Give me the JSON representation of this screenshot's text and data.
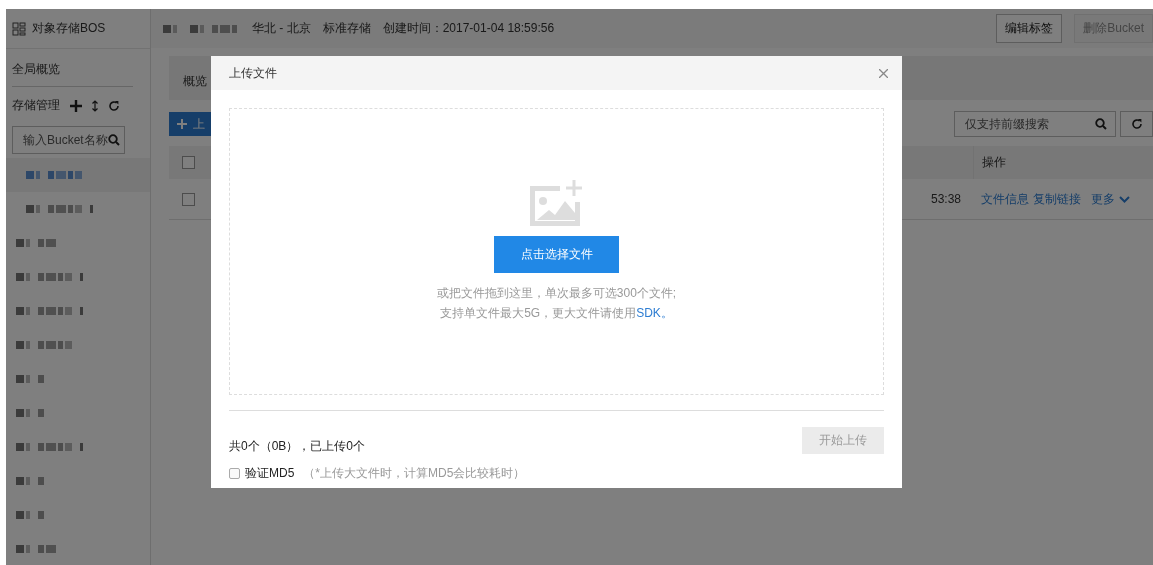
{
  "sidebar": {
    "title": "对象存储BOS",
    "overview": "全局概览",
    "storage_label": "存储管理",
    "search": {
      "placeholder": "输入Bucket名称"
    },
    "buckets": [
      {
        "selected": true
      },
      {
        "selected": false
      },
      {
        "selected": false
      },
      {
        "selected": false
      },
      {
        "selected": false
      },
      {
        "selected": false
      },
      {
        "selected": false
      },
      {
        "selected": false
      },
      {
        "selected": false
      },
      {
        "selected": false
      },
      {
        "selected": false
      },
      {
        "selected": false
      }
    ]
  },
  "header": {
    "region": "华北 - 北京",
    "storage_class": "标准存储",
    "created": "创建时间：2017-01-04 18:59:56",
    "buttons": [
      {
        "label": "编辑标签",
        "disabled": false
      },
      {
        "label": "删除Bucket",
        "disabled": true
      }
    ]
  },
  "tabs": [
    "概览"
  ],
  "toolbar": {
    "upload_button": "上",
    "search": {
      "placeholder": "仅支持前缀搜索"
    }
  },
  "table": {
    "columns": [
      "操作"
    ],
    "header_checkbox": {
      "checked": false
    },
    "rows": [
      {
        "checked": false,
        "time": "53:38",
        "actions": [
          "文件信息",
          "复制链接"
        ],
        "more": "更多"
      }
    ]
  },
  "dialog": {
    "title": "上传文件",
    "select_button": "点击选择文件",
    "hint": "或把文件拖到这里，单次最多可选300个文件;",
    "limit": "支持单文件最大5G，更大文件请使用",
    "sdk_link": "SDK。",
    "summary": "共0个（0B），已上传0个",
    "md5": {
      "label": "验证MD5",
      "checked": false
    },
    "md5_note": "（*上传大文件时，计算MD5会比较耗时）",
    "start_button": {
      "label": "开始上传",
      "disabled": true
    }
  }
}
